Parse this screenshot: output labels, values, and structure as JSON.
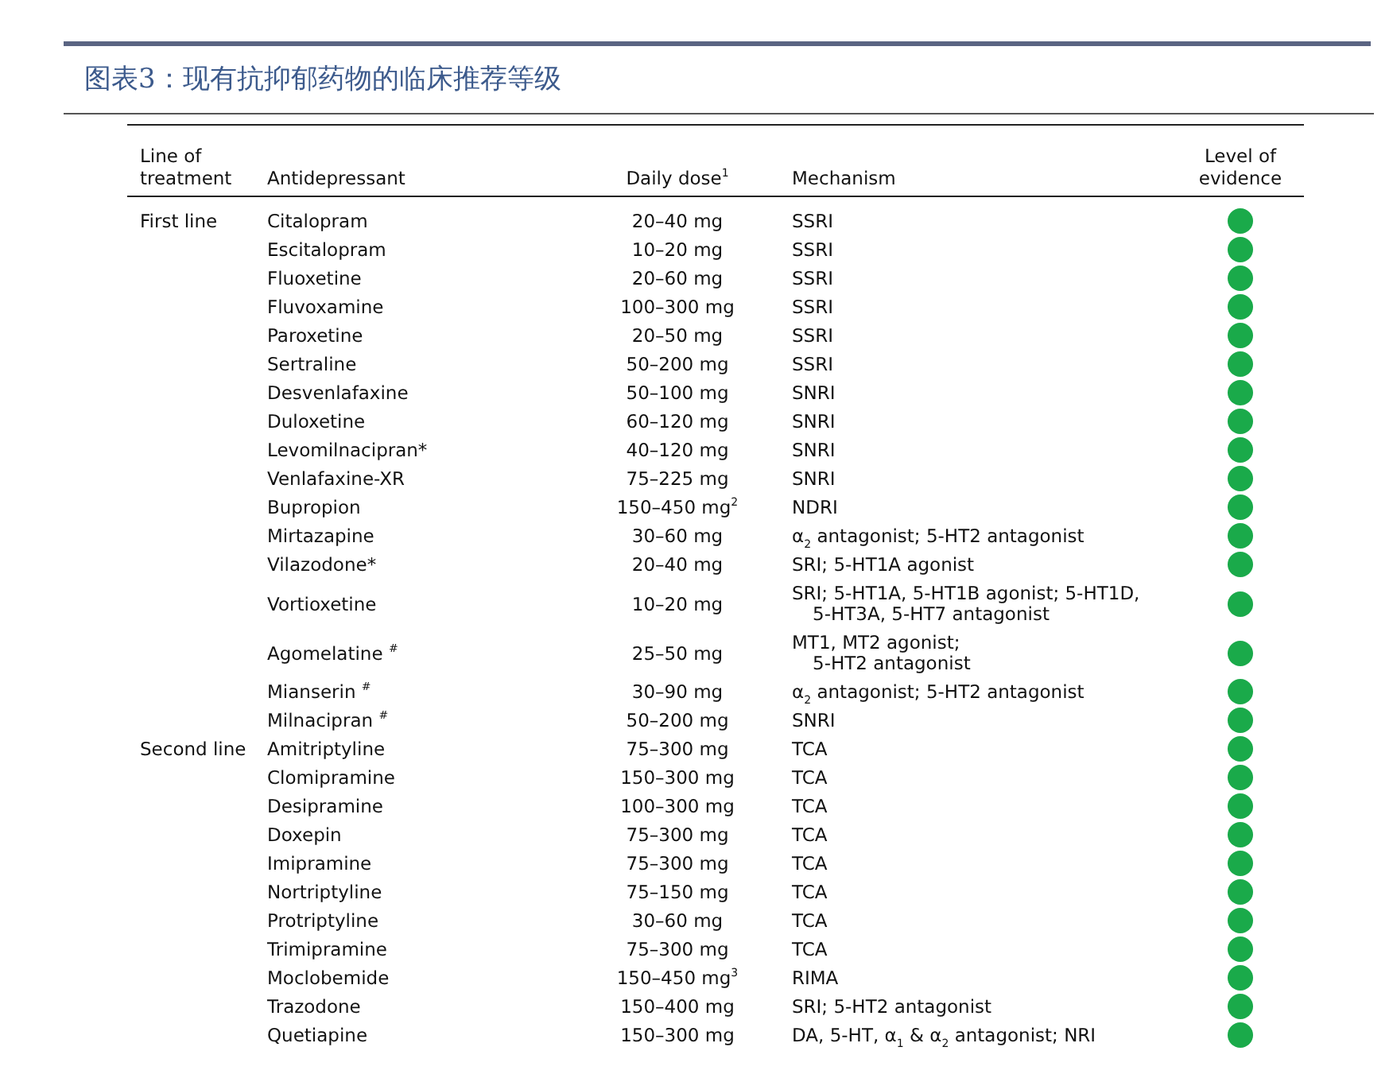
{
  "figure_title": "图表3：现有抗抑郁药物的临床推荐等级",
  "table": {
    "columns": [
      "Line of treatment",
      "Antidepressant",
      "Daily dose$^{1}$",
      "Mechanism",
      "Level of evidence"
    ],
    "groups": [
      {
        "line": "First line",
        "rows": [
          {
            "name": "Citalopram",
            "dose": "20–40 mg",
            "mechanism": [
              "SSRI"
            ],
            "color": "#1aaa4a"
          },
          {
            "name": "Escitalopram",
            "dose": "10–20 mg",
            "mechanism": [
              "SSRI"
            ],
            "color": "#1aaa4a"
          },
          {
            "name": "Fluoxetine",
            "dose": "20–60 mg",
            "mechanism": [
              "SSRI"
            ],
            "color": "#1aaa4a"
          },
          {
            "name": "Fluvoxamine",
            "dose": "100–300 mg",
            "mechanism": [
              "SSRI"
            ],
            "color": "#1aaa4a"
          },
          {
            "name": "Paroxetine",
            "dose": "20–50 mg",
            "mechanism": [
              "SSRI"
            ],
            "color": "#1aaa4a"
          },
          {
            "name": "Sertraline",
            "dose": "50–200 mg",
            "mechanism": [
              "SSRI"
            ],
            "color": "#1aaa4a"
          },
          {
            "name": "Desvenlafaxine",
            "dose": "50–100 mg",
            "mechanism": [
              "SNRI"
            ],
            "color": "#1aaa4a"
          },
          {
            "name": "Duloxetine",
            "dose": "60–120 mg",
            "mechanism": [
              "SNRI"
            ],
            "color": "#1aaa4a"
          },
          {
            "name": "Levomilnacipran*",
            "dose": "40–120 mg",
            "mechanism": [
              "SNRI"
            ],
            "color": "#1aaa4a"
          },
          {
            "name": "Venlafaxine-XR",
            "dose": "75–225 mg",
            "mechanism": [
              "SNRI"
            ],
            "color": "#1aaa4a"
          },
          {
            "name": "Bupropion",
            "dose": "150–450 mg$^{2}$",
            "mechanism": [
              "NDRI"
            ],
            "color": "#1aaa4a"
          },
          {
            "name": "Mirtazapine",
            "dose": "30–60 mg",
            "mechanism": [
              "α$_{2}$ antagonist; 5-HT2 antagonist"
            ],
            "color": "#1aaa4a"
          },
          {
            "name": "Vilazodone*",
            "dose": "20–40 mg",
            "mechanism": [
              "SRI; 5-HT1A agonist"
            ],
            "color": "#1aaa4a"
          },
          {
            "name": "Vortioxetine",
            "dose": "10–20 mg",
            "mechanism": [
              "SRI; 5-HT1A, 5-HT1B agonist; 5-HT1D,",
              "5-HT3A, 5-HT7 antagonist"
            ],
            "color": "#1aaa4a"
          },
          {
            "name": "Agomelatine $^{#}$",
            "dose": "25–50 mg",
            "mechanism": [
              "MT1, MT2 agonist;",
              "5-HT2 antagonist"
            ],
            "color": "#1aaa4a"
          },
          {
            "name": "Mianserin $^{#}$",
            "dose": "30–90 mg",
            "mechanism": [
              "α$_{2}$ antagonist; 5-HT2 antagonist"
            ],
            "color": "#1aaa4a"
          },
          {
            "name": "Milnacipran $^{#}$",
            "dose": "50–200 mg",
            "mechanism": [
              "SNRI"
            ],
            "color": "#1aaa4a"
          }
        ]
      },
      {
        "line": "Second line",
        "rows": [
          {
            "name": "Amitriptyline",
            "dose": "75–300 mg",
            "mechanism": [
              "TCA"
            ],
            "color": "#1aaa4a"
          },
          {
            "name": "Clomipramine",
            "dose": "150–300 mg",
            "mechanism": [
              "TCA"
            ],
            "color": "#1aaa4a"
          },
          {
            "name": "Desipramine",
            "dose": "100–300 mg",
            "mechanism": [
              "TCA"
            ],
            "color": "#1aaa4a"
          },
          {
            "name": "Doxepin",
            "dose": "75–300 mg",
            "mechanism": [
              "TCA"
            ],
            "color": "#1aaa4a"
          },
          {
            "name": "Imipramine",
            "dose": "75–300 mg",
            "mechanism": [
              "TCA"
            ],
            "color": "#1aaa4a"
          },
          {
            "name": "Nortriptyline",
            "dose": "75–150 mg",
            "mechanism": [
              "TCA"
            ],
            "color": "#1aaa4a"
          },
          {
            "name": "Protriptyline",
            "dose": "30–60 mg",
            "mechanism": [
              "TCA"
            ],
            "color": "#1aaa4a"
          },
          {
            "name": "Trimipramine",
            "dose": "75–300 mg",
            "mechanism": [
              "TCA"
            ],
            "color": "#1aaa4a"
          },
          {
            "name": "Moclobemide",
            "dose": "150–450 mg$^{3}$",
            "mechanism": [
              "RIMA"
            ],
            "color": "#1aaa4a"
          },
          {
            "name": "Trazodone",
            "dose": "150–400 mg",
            "mechanism": [
              "SRI; 5-HT2 antagonist"
            ],
            "color": "#1aaa4a"
          },
          {
            "name": "Quetiapine",
            "dose": "150–300 mg",
            "mechanism": [
              "DA, 5-HT, α$_{1}$ & α$_{2}$ antagonist; NRI"
            ],
            "color": "#1aaa4a"
          }
        ]
      }
    ]
  }
}
